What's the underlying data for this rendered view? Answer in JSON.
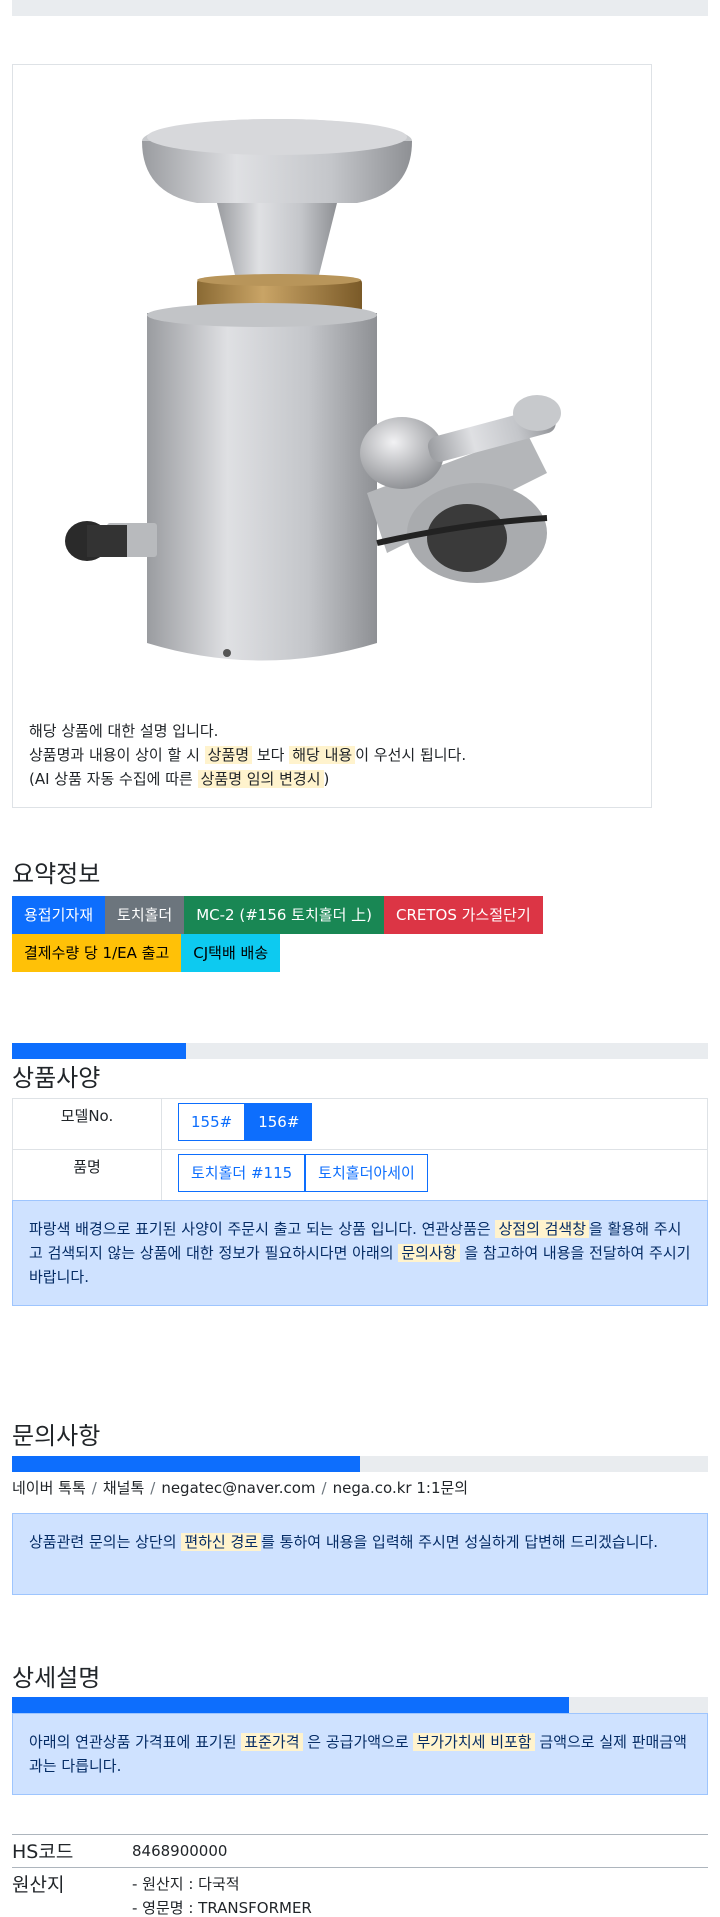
{
  "card": {
    "line1": "해당 상품에 대한 설명 입니다.",
    "line2_a": "상품명과 내용이 상이 할 시",
    "line2_hl1": "상품명",
    "line2_b": "보다",
    "line2_hl2": "해당 내용",
    "line2_c": "이 우선시 됩니다.",
    "line3_a": "(AI 상품 자동 수집에 따른",
    "line3_hl": "상품명 임의 변경시",
    "line3_b": ")"
  },
  "summary": {
    "title": "요약정보",
    "badges": [
      "용접기자재",
      "토치홀더",
      "MC-2 (#156 토치홀더 上)",
      "CRETOS 가스절단기",
      "결제수량 당 1/EA 출고",
      "CJ택배 배송"
    ],
    "badge_colors": [
      "#0d6efd",
      "#6c757d",
      "#198754",
      "#dc3545",
      "#ffc107",
      "#0dcaf0"
    ]
  },
  "specs": {
    "progress_percent": 25,
    "title": "상품사양",
    "rows": [
      {
        "label": "모델No.",
        "options": [
          "155#",
          "156#"
        ],
        "active_index": 1
      },
      {
        "label": "품명",
        "options": [
          "토치홀더 #115",
          "토치홀더아세이"
        ],
        "active_index": -1
      }
    ],
    "notice_a": "파랑색 배경으로 표기된 사양이 주문시 출고 되는 상품 입니다. 연관상품은",
    "notice_hl1": "상점의 검색창",
    "notice_b": "을 활용해 주시고 검색되지 않는 상품에 대한 정보가 필요하시다면 아래의",
    "notice_hl2": "문의사항",
    "notice_c": "을 참고하여 내용을 전달하여 주시기 바랍니다."
  },
  "inquiry": {
    "title": "문의사항",
    "progress_percent": 50,
    "contacts": [
      "네이버 톡톡",
      "채널톡",
      "negatec@naver.com",
      "nega.co.kr 1:1문의"
    ],
    "separator": "/",
    "notice_a": "상품관련 문의는 상단의",
    "notice_hl": "편하신 경로",
    "notice_b": "를 통하여 내용을 입력해 주시면 성실하게 답변해 드리겠습니다."
  },
  "detail": {
    "title": "상세설명",
    "progress_percent": 80,
    "notice_a": "아래의 연관상품 가격표에 표기된",
    "notice_hl1": "표준가격",
    "notice_b": "은 공급가액으로",
    "notice_hl2": "부가가치세 비포함",
    "notice_c": "금액으로 실제 판매금액과는 다릅니다.",
    "hs_key": "HS코드",
    "hs_value": "8468900000",
    "origin_key": "원산지",
    "origin_line1": "- 원산지 : 다국적",
    "origin_line2": "- 영문명 : TRANSFORMER"
  }
}
